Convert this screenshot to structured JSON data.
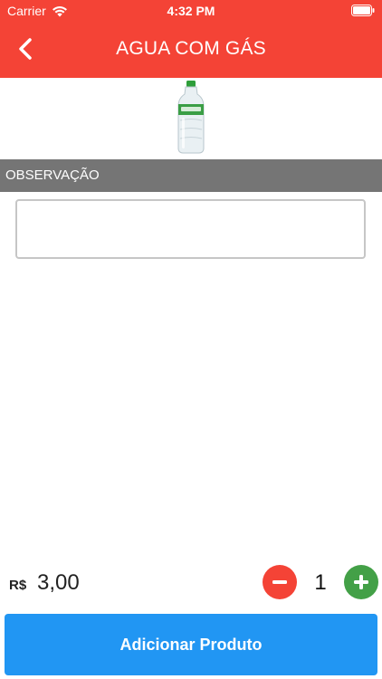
{
  "status_bar": {
    "carrier": "Carrier",
    "time": "4:32 PM"
  },
  "header": {
    "title": "AGUA COM GÁS",
    "back_icon": "chevron-left-icon"
  },
  "product": {
    "image": "water-bottle-image"
  },
  "observation": {
    "section_label": "OBSERVAÇÃO",
    "value": ""
  },
  "price": {
    "currency": "R$",
    "amount": "3,00"
  },
  "quantity": {
    "value": "1",
    "minus_icon": "minus-icon",
    "plus_icon": "plus-icon"
  },
  "actions": {
    "add_label": "Adicionar Produto"
  },
  "colors": {
    "primary": "#f44336",
    "section": "#757575",
    "add": "#2196f3",
    "plus": "#43a047"
  }
}
